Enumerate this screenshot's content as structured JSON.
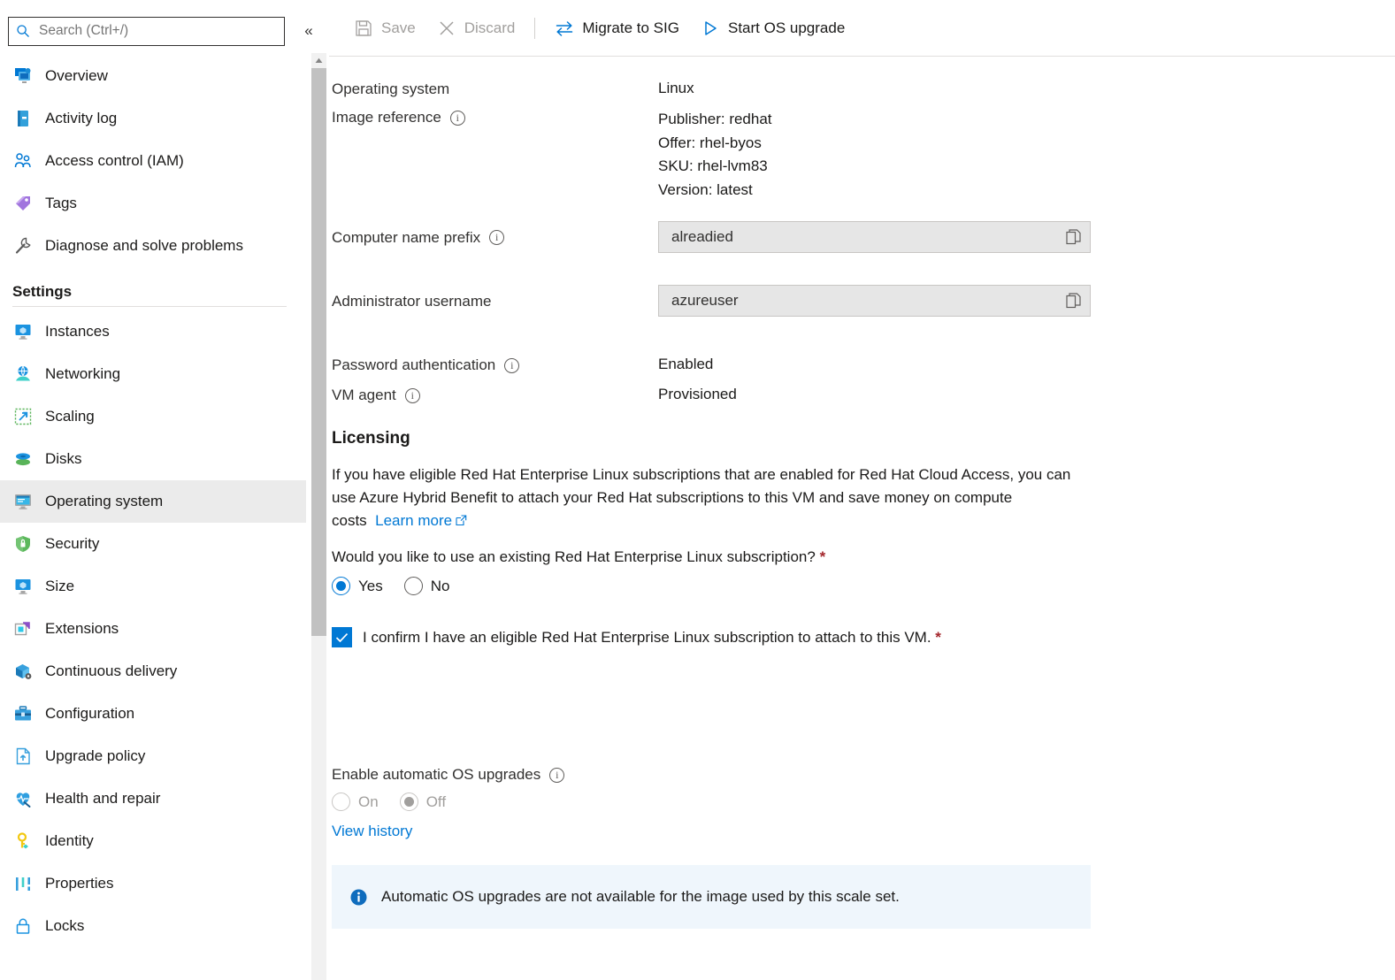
{
  "sidebar": {
    "search": {
      "placeholder": "Search (Ctrl+/)",
      "value": ""
    },
    "collapse_label": "«",
    "items": [
      {
        "label": "Overview",
        "icon": "overview-icon"
      },
      {
        "label": "Activity log",
        "icon": "activity-log-icon"
      },
      {
        "label": "Access control (IAM)",
        "icon": "access-control-icon"
      },
      {
        "label": "Tags",
        "icon": "tags-icon"
      },
      {
        "label": "Diagnose and solve problems",
        "icon": "diagnose-icon"
      }
    ],
    "settings_header": "Settings",
    "settings_items": [
      {
        "label": "Instances",
        "icon": "instances-icon"
      },
      {
        "label": "Networking",
        "icon": "networking-icon"
      },
      {
        "label": "Scaling",
        "icon": "scaling-icon"
      },
      {
        "label": "Disks",
        "icon": "disks-icon"
      },
      {
        "label": "Operating system",
        "icon": "operating-system-icon",
        "selected": true
      },
      {
        "label": "Security",
        "icon": "security-icon"
      },
      {
        "label": "Size",
        "icon": "size-icon"
      },
      {
        "label": "Extensions",
        "icon": "extensions-icon"
      },
      {
        "label": "Continuous delivery",
        "icon": "continuous-delivery-icon"
      },
      {
        "label": "Configuration",
        "icon": "configuration-icon"
      },
      {
        "label": "Upgrade policy",
        "icon": "upgrade-policy-icon"
      },
      {
        "label": "Health and repair",
        "icon": "health-and-repair-icon"
      },
      {
        "label": "Identity",
        "icon": "identity-icon"
      },
      {
        "label": "Properties",
        "icon": "properties-icon"
      },
      {
        "label": "Locks",
        "icon": "locks-icon"
      }
    ]
  },
  "toolbar": {
    "save_label": "Save",
    "save_disabled": true,
    "discard_label": "Discard",
    "discard_disabled": true,
    "migrate_label": "Migrate to SIG",
    "start_upgrade_label": "Start OS upgrade"
  },
  "form": {
    "operating_system_label": "Operating system",
    "operating_system_value": "Linux",
    "image_reference_label": "Image reference",
    "image_reference_lines": [
      "Publisher: redhat",
      "Offer: rhel-byos",
      "SKU: rhel-lvm83",
      "Version: latest"
    ],
    "computer_name_prefix_label": "Computer name prefix",
    "computer_name_prefix_value": "alreadied",
    "administrator_username_label": "Administrator username",
    "administrator_username_value": "azureuser",
    "password_authentication_label": "Password authentication",
    "password_authentication_value": "Enabled",
    "vm_agent_label": "VM agent",
    "vm_agent_value": "Provisioned"
  },
  "licensing": {
    "heading": "Licensing",
    "description": "If you have eligible Red Hat Enterprise Linux subscriptions that are enabled for Red Hat Cloud Access, you can use Azure Hybrid Benefit to attach your Red Hat subscriptions to this VM and save money on compute costs",
    "learn_more": "Learn more",
    "question": "Would you like to use an existing Red Hat Enterprise Linux subscription?",
    "required_marker": "*",
    "yes_label": "Yes",
    "no_label": "No",
    "selected": "Yes",
    "confirm_label": "I confirm I have an eligible Red Hat Enterprise Linux subscription to attach to this VM.",
    "confirm_checked": true
  },
  "auto_upgrade": {
    "label": "Enable automatic OS upgrades",
    "on_label": "On",
    "off_label": "Off",
    "selected": "Off",
    "disabled": true,
    "view_history": "View history",
    "banner_text": "Automatic OS upgrades are not available for the image used by this scale set."
  },
  "colors": {
    "accent": "#0078d4",
    "required": "#a4262c",
    "banner_bg": "#eff6fc",
    "selected_row": "#ebebeb",
    "field_bg": "#e6e6e6"
  }
}
